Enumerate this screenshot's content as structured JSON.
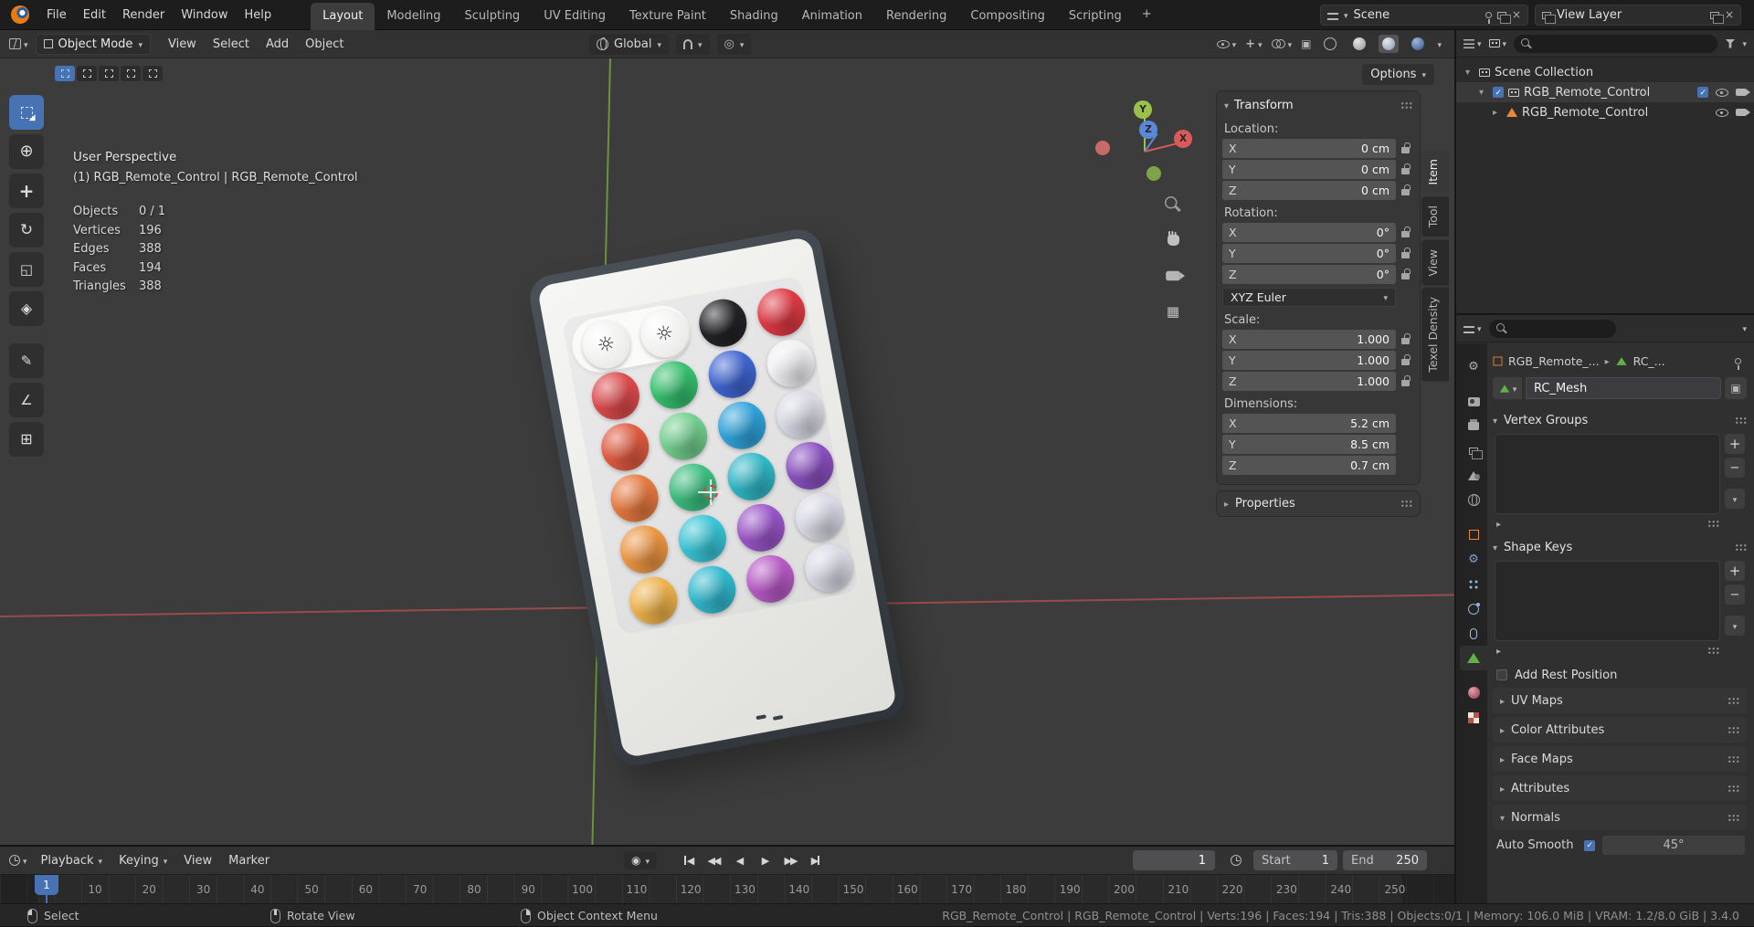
{
  "topbar": {
    "menus": [
      "File",
      "Edit",
      "Render",
      "Window",
      "Help"
    ],
    "workspaces": [
      "Layout",
      "Modeling",
      "Sculpting",
      "UV Editing",
      "Texture Paint",
      "Shading",
      "Animation",
      "Rendering",
      "Compositing",
      "Scripting"
    ],
    "active_workspace": "Layout",
    "new_workspace_label": "+",
    "scene_selector_label": "Scene",
    "view_layer_selector_label": "View Layer"
  },
  "viewport_header": {
    "mode": "Object Mode",
    "menus": [
      "View",
      "Select",
      "Add",
      "Object"
    ],
    "orientation": "Global"
  },
  "tools": [
    "tweak-select",
    "cursor",
    "move",
    "rotate",
    "scale",
    "transform",
    "annotate",
    "measure",
    "add-cube"
  ],
  "active_tool": "tweak-select",
  "select_modes": [
    "new",
    "extend",
    "subtract",
    "invert",
    "intersect"
  ],
  "viewport": {
    "options_label": "Options",
    "overlay": {
      "view_label": "User Perspective",
      "object_label": "(1) RGB_Remote_Control | RGB_Remote_Control",
      "stats": [
        {
          "label": "Objects",
          "value": "0 / 1"
        },
        {
          "label": "Vertices",
          "value": "196"
        },
        {
          "label": "Edges",
          "value": "388"
        },
        {
          "label": "Faces",
          "value": "194"
        },
        {
          "label": "Triangles",
          "value": "388"
        }
      ]
    },
    "gizmo": {
      "x": "X",
      "y": "Y",
      "z": "Z"
    },
    "remote_buttons": [
      {
        "row": 0,
        "col": 0,
        "kind": "sun"
      },
      {
        "row": 0,
        "col": 1,
        "kind": "sun"
      },
      {
        "row": 0,
        "col": 2,
        "color": "#232327"
      },
      {
        "row": 0,
        "col": 3,
        "color": "#de3a43"
      },
      {
        "row": 1,
        "col": 0,
        "color": "#dd4a4c"
      },
      {
        "row": 1,
        "col": 1,
        "color": "#35c06e"
      },
      {
        "row": 1,
        "col": 2,
        "color": "#3f65d2"
      },
      {
        "row": 1,
        "col": 3,
        "color": "#f0f0f3"
      },
      {
        "row": 2,
        "col": 0,
        "color": "#e05a40"
      },
      {
        "row": 2,
        "col": 1,
        "color": "#72ce8e"
      },
      {
        "row": 2,
        "col": 2,
        "color": "#2fa2da"
      },
      {
        "row": 2,
        "col": 3,
        "color": "#dadae6"
      },
      {
        "row": 3,
        "col": 0,
        "color": "#e6793f"
      },
      {
        "row": 3,
        "col": 1,
        "color": "#3abd7d"
      },
      {
        "row": 3,
        "col": 2,
        "color": "#2fb7c6"
      },
      {
        "row": 3,
        "col": 3,
        "color": "#8a50c0"
      },
      {
        "row": 4,
        "col": 0,
        "color": "#ec9542"
      },
      {
        "row": 4,
        "col": 1,
        "color": "#38c5d6"
      },
      {
        "row": 4,
        "col": 2,
        "color": "#9a55c8"
      },
      {
        "row": 4,
        "col": 3,
        "color": "#dadae6"
      },
      {
        "row": 5,
        "col": 0,
        "color": "#eeb24b"
      },
      {
        "row": 5,
        "col": 1,
        "color": "#31b9cf"
      },
      {
        "row": 5,
        "col": 2,
        "color": "#b75ac5"
      },
      {
        "row": 5,
        "col": 3,
        "color": "#dadae6"
      }
    ]
  },
  "npanel": {
    "title": "Transform",
    "tabs": [
      "Item",
      "Tool",
      "View",
      "Texel Density"
    ],
    "active_tab": "Item",
    "location": {
      "label": "Location:",
      "rows": [
        {
          "axis": "X",
          "value": "0 cm",
          "lock": true
        },
        {
          "axis": "Y",
          "value": "0 cm",
          "lock": true
        },
        {
          "axis": "Z",
          "value": "0 cm",
          "lock": true
        }
      ]
    },
    "rotation": {
      "label": "Rotation:",
      "rows": [
        {
          "axis": "X",
          "value": "0°",
          "lock": true
        },
        {
          "axis": "Y",
          "value": "0°",
          "lock": true
        },
        {
          "axis": "Z",
          "value": "0°",
          "lock": true
        }
      ]
    },
    "rotation_mode": "XYZ Euler",
    "scale": {
      "label": "Scale:",
      "rows": [
        {
          "axis": "X",
          "value": "1.000",
          "lock": true
        },
        {
          "axis": "Y",
          "value": "1.000",
          "lock": true
        },
        {
          "axis": "Z",
          "value": "1.000",
          "lock": true
        }
      ]
    },
    "dimensions": {
      "label": "Dimensions:",
      "rows": [
        {
          "axis": "X",
          "value": "5.2 cm",
          "lock": false
        },
        {
          "axis": "Y",
          "value": "8.5 cm",
          "lock": false
        },
        {
          "axis": "Z",
          "value": "0.7 cm",
          "lock": false
        }
      ]
    },
    "properties_label": "Properties"
  },
  "outliner": {
    "rows": [
      {
        "depth": 0,
        "expanded": true,
        "icon": "collection",
        "label": "Scene Collection",
        "checkbox": false,
        "right": [],
        "highlight": false
      },
      {
        "depth": 1,
        "expanded": true,
        "icon": "collection",
        "label": "RGB_Remote_Control",
        "checkbox": true,
        "right": [
          "checkbox",
          "eye",
          "camera"
        ],
        "highlight": true
      },
      {
        "depth": 2,
        "expanded": false,
        "icon": "mesh",
        "label": "RGB_Remote_Control",
        "checkbox": false,
        "right": [
          "eye",
          "camera"
        ],
        "highlight": false
      }
    ]
  },
  "properties": {
    "tabs": [
      {
        "id": "tool",
        "gap": false,
        "active": false
      },
      {
        "id": "render",
        "gap": true,
        "active": false
      },
      {
        "id": "output",
        "gap": false,
        "active": false
      },
      {
        "id": "view-layer",
        "gap": false,
        "active": false
      },
      {
        "id": "scene",
        "gap": false,
        "active": false
      },
      {
        "id": "world",
        "gap": false,
        "active": false
      },
      {
        "id": "object",
        "gap": true,
        "active": false
      },
      {
        "id": "modifiers",
        "gap": false,
        "active": false
      },
      {
        "id": "particles",
        "gap": false,
        "active": false
      },
      {
        "id": "physics",
        "gap": false,
        "active": false
      },
      {
        "id": "constraints",
        "gap": false,
        "active": false
      },
      {
        "id": "data",
        "gap": false,
        "active": true
      },
      {
        "id": "material",
        "gap": true,
        "active": false
      },
      {
        "id": "texture",
        "gap": false,
        "active": false
      }
    ],
    "breadcrumb": {
      "object": "RGB_Remote_...",
      "data": "RC_..."
    },
    "name_value": "RC_Mesh",
    "vertex_groups_title": "Vertex Groups",
    "shape_keys_title": "Shape Keys",
    "add_rest_position_label": "Add Rest Position",
    "collapsed_panels": [
      "UV Maps",
      "Color Attributes",
      "Face Maps",
      "Attributes"
    ],
    "normals": {
      "title": "Normals",
      "auto_smooth_label": "Auto Smooth",
      "auto_smooth_checked": true,
      "angle_value": "45°"
    }
  },
  "timeline": {
    "menus": [
      "Playback",
      "Keying",
      "View",
      "Marker"
    ],
    "current_frame": "1",
    "playhead_frame": "1",
    "start_label": "Start",
    "start_value": "1",
    "end_label": "End",
    "end_value": "250",
    "ruler_frames": [
      10,
      20,
      30,
      40,
      50,
      60,
      70,
      80,
      90,
      100,
      110,
      120,
      130,
      140,
      150,
      160,
      170,
      180,
      190,
      200,
      210,
      220,
      230,
      240,
      250
    ]
  },
  "statusbar": {
    "hints": [
      {
        "mouse": "left",
        "label": "Select"
      },
      {
        "mouse": "middle",
        "label": "Rotate View"
      },
      {
        "mouse": "right",
        "label": "Object Context Menu"
      }
    ],
    "info": "RGB_Remote_Control | RGB_Remote_Control | Verts:196 | Faces:194 | Tris:388 | Objects:0/1 | Memory: 106.0 MiB | VRAM: 1.2/8.0 GiB | 3.4.0"
  },
  "colors": {
    "accent": "#4772b3",
    "axis_x": "#b34d4d",
    "axis_y": "#6fa53a",
    "data_tab_green": "#5fb344",
    "object_orange": "#e8883a"
  }
}
